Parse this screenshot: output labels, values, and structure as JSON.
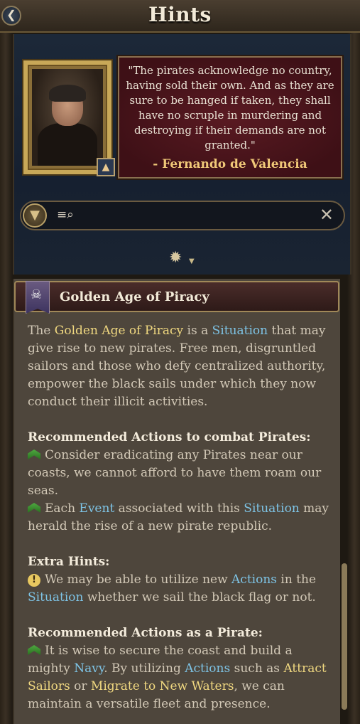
{
  "window": {
    "title": "Hints",
    "back_icon": "back-arrow-icon"
  },
  "quote": {
    "text": "\"The pirates acknowledge no country, having sold their own. And as they are sure to be hanged if taken, they shall have no scruple in murdering and destroying if their demands are not granted.\"",
    "author": "- Fernando de Valencia"
  },
  "search": {
    "value": "",
    "placeholder": ""
  },
  "section": {
    "title": "Golden Age of Piracy",
    "intro": {
      "p1": "The ",
      "golden_age": "Golden Age of Piracy",
      "p2": " is a ",
      "situation": "Situation",
      "p3": " that may give rise to new pirates. Free men, disgruntled sailors and those who defy centralized authority, empower the black sails under which they now conduct their illicit activities."
    },
    "combat": {
      "heading": "Recommended Actions to combat Pirates:",
      "item1": "Consider eradicating any Pirates near our coasts, we cannot afford to have them roam our seas.",
      "item2_a": "Each ",
      "item2_event": "Event",
      "item2_b": " associated with this ",
      "item2_situation": "Situation",
      "item2_c": " may herald  the rise of a new pirate republic."
    },
    "extra": {
      "heading": "Extra Hints:",
      "a": "We may be able to utilize new ",
      "actions": "Actions",
      "b": " in the ",
      "situation": "Situation",
      "c": " whether we sail the black flag or not."
    },
    "pirate": {
      "heading": "Recommended Actions as a Pirate:",
      "a": "It is wise to secure the coast and build a mighty ",
      "navy": "Navy",
      "b": ". By utilizing ",
      "actions": "Actions",
      "c": " such as ",
      "attract": "Attract Sailors",
      "d": " or ",
      "migrate": "Migrate to New Waters",
      "e": ", we can maintain a versatile fleet and presence."
    }
  }
}
